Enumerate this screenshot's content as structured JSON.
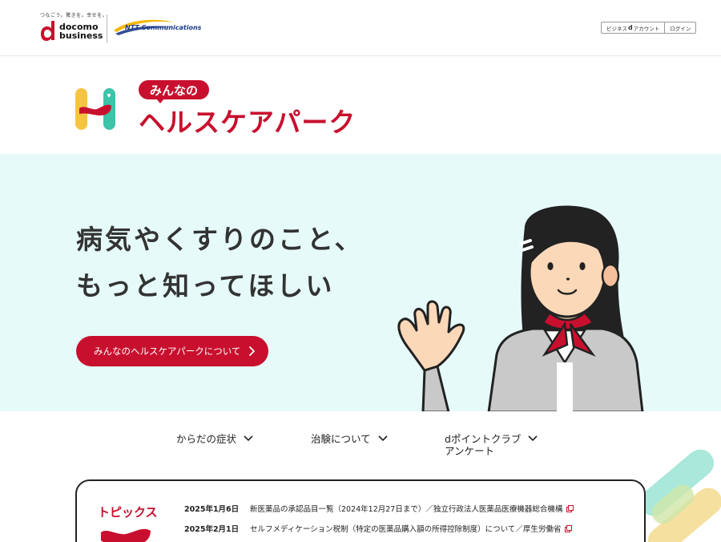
{
  "header": {
    "docomo_tagline": "つなごう。驚きを。幸せを。",
    "docomo_word_1": "docomo",
    "docomo_word_2": "business",
    "ntt_text": "NTT Communications",
    "login_prefix": "ビジネス",
    "login_d": "d",
    "login_account": "アカウント",
    "login_label": "ログイン"
  },
  "brand": {
    "badge": "みんなの",
    "title": "ヘルスケアパーク"
  },
  "hero": {
    "headline_1": "病気やくすりのこと、",
    "headline_2": "もっと知ってほしい",
    "button_label": "みんなのヘルスケアパークについて"
  },
  "nav": {
    "items": [
      {
        "label": "からだの症状"
      },
      {
        "label": "治験について"
      },
      {
        "label": "dポイントクラブ\nアンケート"
      }
    ]
  },
  "topics": {
    "title": "トピックス",
    "news": [
      {
        "date": "2025年1月6日",
        "text": "新医薬品の承認品目一覧（2024年12月27日まで）／独立行政法人医薬品医療機器総合機構"
      },
      {
        "date": "2025年2月1日",
        "text": "セルフメディケーション税制（特定の医薬品購入額の所得控除制度）について／厚生労働省"
      }
    ]
  },
  "colors": {
    "brand_red": "#c8102e",
    "hero_bg": "#e6fafa",
    "ntt_blue": "#1d3b8a"
  }
}
